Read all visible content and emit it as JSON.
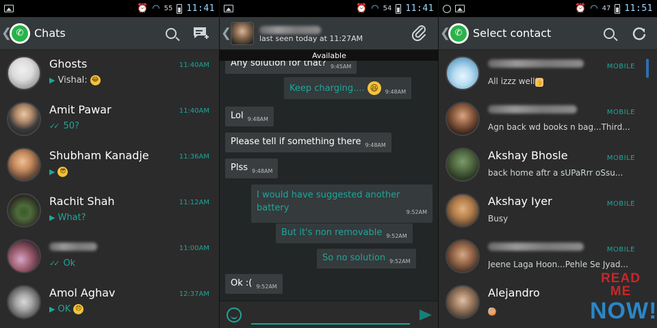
{
  "colors": {
    "accent_teal": "#1fa69a",
    "actionbar": "#34393b",
    "background": "#2b2b2b",
    "status_time": "#9fd9ff",
    "watermark_red": "#c7272b",
    "watermark_blue": "#2b86c8"
  },
  "panel_chats": {
    "status": {
      "battery": "55",
      "time": "11:41"
    },
    "title": "Chats",
    "icons": [
      "whatsapp-logo-icon",
      "search-icon",
      "new-chat-icon"
    ],
    "rows": [
      {
        "name": "Ghosts",
        "message": "Vishal:",
        "time": "11:40AM",
        "emoji": "😂"
      },
      {
        "name": "Amit Pawar",
        "message": "50?",
        "time": "11:40AM"
      },
      {
        "name": "Shubham Kanadje",
        "message": "",
        "time": "11:36AM",
        "emoji": "😎"
      },
      {
        "name": "Rachit Shah",
        "message": "What?",
        "time": "11:12AM"
      },
      {
        "name": "",
        "message": "Ok",
        "time": "11:00AM"
      },
      {
        "name": "Amol Aghav",
        "message": "OK",
        "time": "12:37AM",
        "emoji": "😞"
      }
    ]
  },
  "panel_conversation": {
    "status": {
      "battery": "54",
      "time": "11:41"
    },
    "last_seen": "last seen today at 11:27AM",
    "available": "Available",
    "messages": [
      {
        "text": "Any solution for that?",
        "time": "9:45AM",
        "me": false
      },
      {
        "text": "Keep charging....",
        "time": "9:48AM",
        "me": true,
        "emoji": "😆"
      },
      {
        "text": "Lol",
        "time": "9:48AM",
        "me": false
      },
      {
        "text": "Please tell if something there",
        "time": "9:48AM",
        "me": false
      },
      {
        "text": "Plss",
        "time": "9:48AM",
        "me": false
      },
      {
        "text": "I would have suggested another battery",
        "time": "9:52AM",
        "me": true
      },
      {
        "text": "But it's non removable",
        "time": "9:52AM",
        "me": true
      },
      {
        "text": "So no solution",
        "time": "9:52AM",
        "me": true
      },
      {
        "text": "Ok :(",
        "time": "9:52AM",
        "me": false
      }
    ]
  },
  "panel_contacts": {
    "status": {
      "battery": "47",
      "time": "11:51"
    },
    "title": "Select contact",
    "mobile_label": "MOBILE",
    "rows": [
      {
        "name": "",
        "status": "All izzz well",
        "emoji": "👍",
        "mobile": true
      },
      {
        "name": "",
        "status": "Agn back wd books n bag...Third...",
        "mobile": true
      },
      {
        "name": "Akshay Bhosle",
        "status": "back home aftr a sUPaRrr oSsu...",
        "mobile": true
      },
      {
        "name": "Akshay Iyer",
        "status": "Busy",
        "mobile": true
      },
      {
        "name": "",
        "status": "Jeene Laga Hoon...Pehle Se Jyad...",
        "mobile": true
      },
      {
        "name": "Alejandro",
        "status": "",
        "emoji": "🍭",
        "mobile": false
      }
    ]
  },
  "watermark": {
    "top": "READ ME",
    "bottom": "NOW!"
  }
}
